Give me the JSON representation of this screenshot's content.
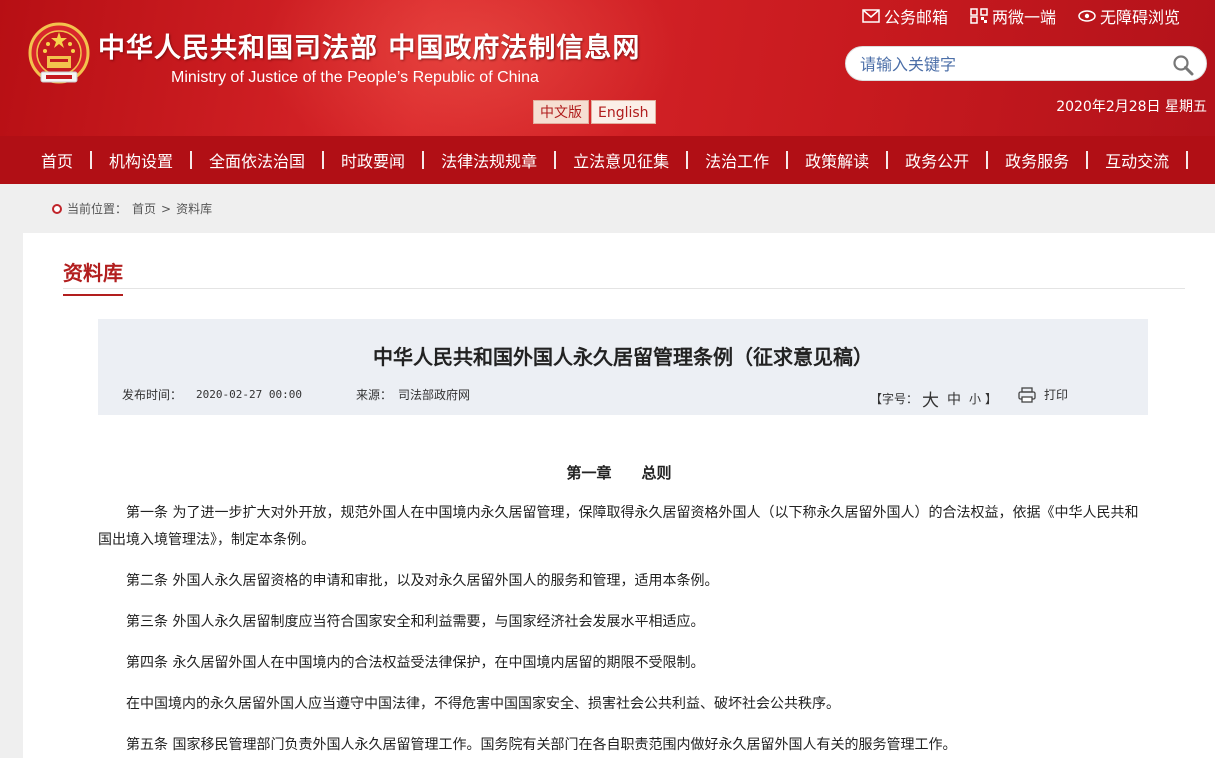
{
  "header": {
    "title": "中华人民共和国司法部  中国政府法制信息网",
    "subtitle": "Ministry of Justice of the People’s Republic of China",
    "lang": {
      "chinese": "中文版",
      "english": "English"
    },
    "top_links": [
      {
        "label": "公务邮箱",
        "icon": "mail-icon"
      },
      {
        "label": "两微一端",
        "icon": "qr-icon"
      },
      {
        "label": "无障碍浏览",
        "icon": "eye-icon"
      }
    ],
    "search_placeholder": "请输入关键字",
    "date": "2020年2月28日 星期五"
  },
  "nav": [
    "首页",
    "机构设置",
    "全面依法治国",
    "时政要闻",
    "法律法规规章",
    "立法意见征集",
    "法治工作",
    "政策解读",
    "政务公开",
    "政务服务",
    "互动交流"
  ],
  "breadcrumb": {
    "prefix": "当前位置：",
    "home": "首页",
    "sep": ">",
    "current": "资料库"
  },
  "section_title": "资料库",
  "article": {
    "title": "中华人民共和国外国人永久居留管理条例（征求意见稿）",
    "pub_label": "发布时间：",
    "pub_time": "2020-02-27 00:00",
    "source_label": "来源：",
    "source": "司法部政府网",
    "fontsize_prefix": "【字号：",
    "fontsize_large": "大",
    "fontsize_medium": "中",
    "fontsize_small": "小",
    "fontsize_suffix": "】",
    "print": "打印",
    "chapter": "第一章　　总则",
    "paragraphs": [
      "第一条  为了进一步扩大对外开放，规范外国人在中国境内永久居留管理，保障取得永久居留资格外国人（以下称永久居留外国人）的合法权益，依据《中华人民共和国出境入境管理法》，制定本条例。",
      "第二条  外国人永久居留资格的申请和审批，以及对永久居留外国人的服务和管理，适用本条例。",
      "第三条  外国人永久居留制度应当符合国家安全和利益需要，与国家经济社会发展水平相适应。",
      "第四条  永久居留外国人在中国境内的合法权益受法律保护，在中国境内居留的期限不受限制。",
      "在中国境内的永久居留外国人应当遵守中国法律，不得危害中国国家安全、损害社会公共利益、破坏社会公共秩序。",
      "第五条  国家移民管理部门负责外国人永久居留管理工作。国务院有关部门在各自职责范围内做好永久居留外国人有关的服务管理工作。"
    ]
  },
  "colors": {
    "header_red": "#c81a1f",
    "nav_red": "#b10f15",
    "accent": "#b21e1e",
    "meta_bg": "#eceff4"
  }
}
